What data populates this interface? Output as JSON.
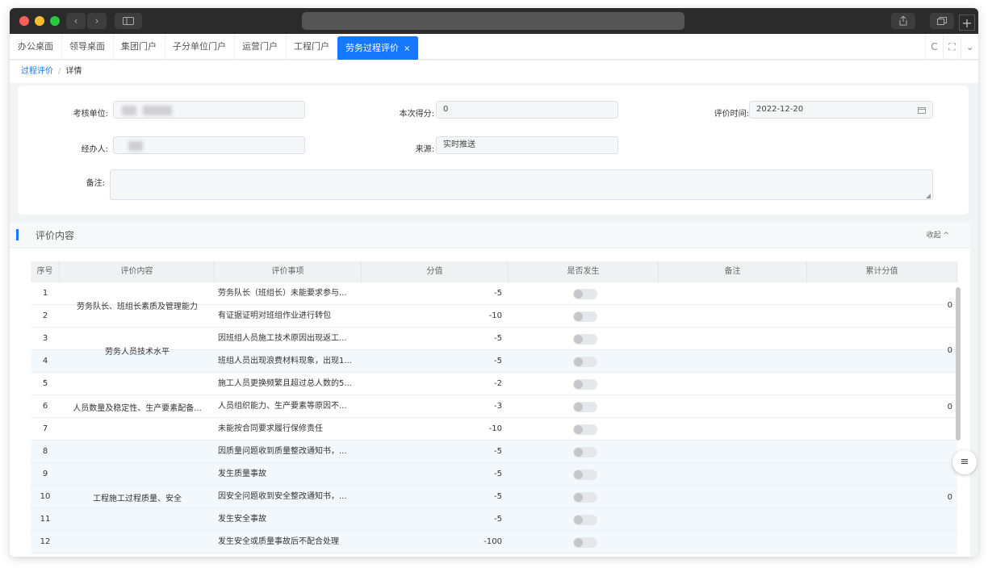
{
  "titlebar": {
    "back": "‹",
    "forward": "›",
    "plus": "+"
  },
  "tabs": [
    {
      "label": "办公桌面",
      "active": false
    },
    {
      "label": "领导桌面",
      "active": false
    },
    {
      "label": "集团门户",
      "active": false
    },
    {
      "label": "子分单位门户",
      "active": false
    },
    {
      "label": "运营门户",
      "active": false
    },
    {
      "label": "工程门户",
      "active": false
    },
    {
      "label": "劳务过程评价",
      "active": true
    }
  ],
  "tab_close": "×",
  "tab_tools": {
    "refresh": "C",
    "fullscreen": "⛶",
    "more": "⌄"
  },
  "breadcrumb": {
    "parent": "过程评价",
    "separator": "/",
    "current": "详情"
  },
  "form": {
    "unit_label": "考核单位:",
    "score_label": "本次得分:",
    "score_value": "0",
    "time_label": "评价时间:",
    "time_value": "2022-12-20",
    "handler_label": "经办人:",
    "source_label": "来源:",
    "source_value": "实时推送",
    "remark_label": "备注:"
  },
  "section": {
    "title": "评价内容",
    "collapse_label": "收起",
    "collapse_icon": "^"
  },
  "table": {
    "headers": [
      "序号",
      "评价内容",
      "评价事项",
      "分值",
      "是否发生",
      "备注",
      "累计分值"
    ],
    "rows": [
      {
        "seq": "1",
        "item": "劳务队长（班组长）未能要求参与...",
        "score": "-5"
      },
      {
        "seq": "2",
        "item": "有证据证明对班组作业进行转包",
        "score": "-10"
      },
      {
        "seq": "3",
        "item": "因班组人员施工技术原因出现返工...",
        "score": "-5"
      },
      {
        "seq": "4",
        "item": "班组人员出现浪费材料现象，出现1...",
        "score": "-5"
      },
      {
        "seq": "5",
        "item": "施工人员更换频繁且超过总人数的5...",
        "score": "-2"
      },
      {
        "seq": "6",
        "item": "人员组织能力、生产要素等原因不...",
        "score": "-3"
      },
      {
        "seq": "7",
        "item": "未能按合同要求履行保修责任",
        "score": "-10"
      },
      {
        "seq": "8",
        "item": "因质量问题收到质量整改通知书，...",
        "score": "-5"
      },
      {
        "seq": "9",
        "item": "发生质量事故",
        "score": "-5"
      },
      {
        "seq": "10",
        "item": "因安全问题收到安全整改通知书，...",
        "score": "-5"
      },
      {
        "seq": "11",
        "item": "发生安全事故",
        "score": "-5"
      },
      {
        "seq": "12",
        "item": "发生安全或质量事故后不配合处理",
        "score": "-100"
      }
    ],
    "groups": [
      {
        "label": "劳务队长、班组长素质及管理能力",
        "cumulative": "0"
      },
      {
        "label": "劳务人员技术水平",
        "cumulative": "0"
      },
      {
        "label": "人员数量及稳定性、生产要素配备...",
        "cumulative": "0"
      },
      {
        "label": "工程施工过程质量、安全",
        "cumulative": "0"
      }
    ]
  },
  "fab_icon": "≡"
}
